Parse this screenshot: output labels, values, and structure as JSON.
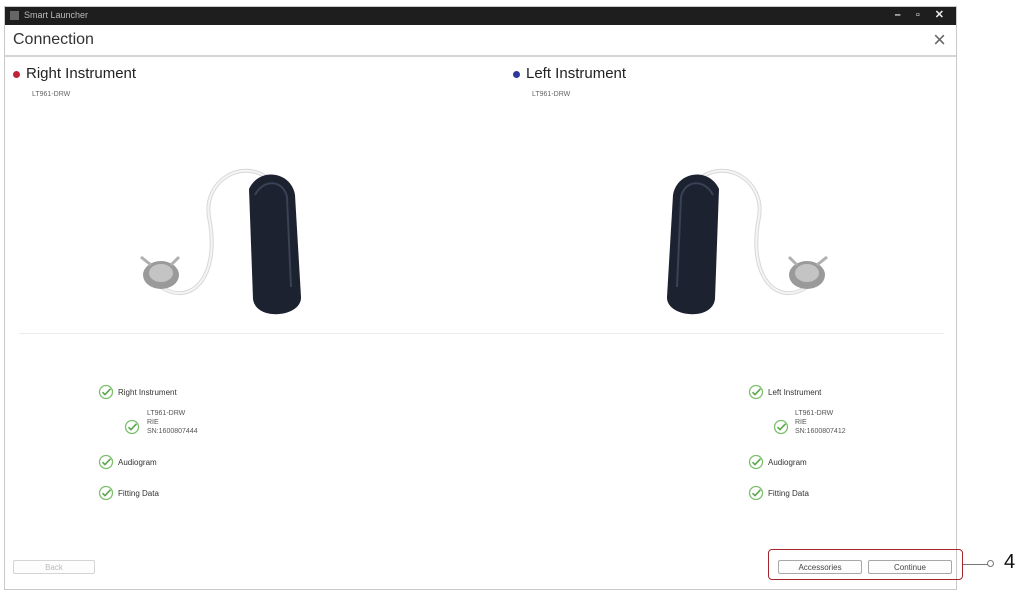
{
  "titlebar": {
    "title": "Smart Launcher",
    "controls": "– ▫ ✕"
  },
  "header": {
    "title": "Connection",
    "close_icon": "×"
  },
  "right": {
    "label": "Right Instrument",
    "model": "LT961-DRW",
    "dot_color": "#c0223a",
    "checks": {
      "instrument": "Right Instrument",
      "audiogram": "Audiogram",
      "fitting": "Fitting Data"
    },
    "details": [
      "LT961-DRW",
      "RIE",
      "SN:1600807444"
    ]
  },
  "left": {
    "label": "Left Instrument",
    "model": "LT961-DRW",
    "dot_color": "#2d3a9b",
    "checks": {
      "instrument": "Left Instrument",
      "audiogram": "Audiogram",
      "fitting": "Fitting Data"
    },
    "details": [
      "LT961-DRW",
      "RIE",
      "SN:1600807412"
    ]
  },
  "footer": {
    "back": "Back",
    "accessories": "Accessories",
    "continue": "Continue"
  },
  "callout": {
    "number": "4"
  }
}
